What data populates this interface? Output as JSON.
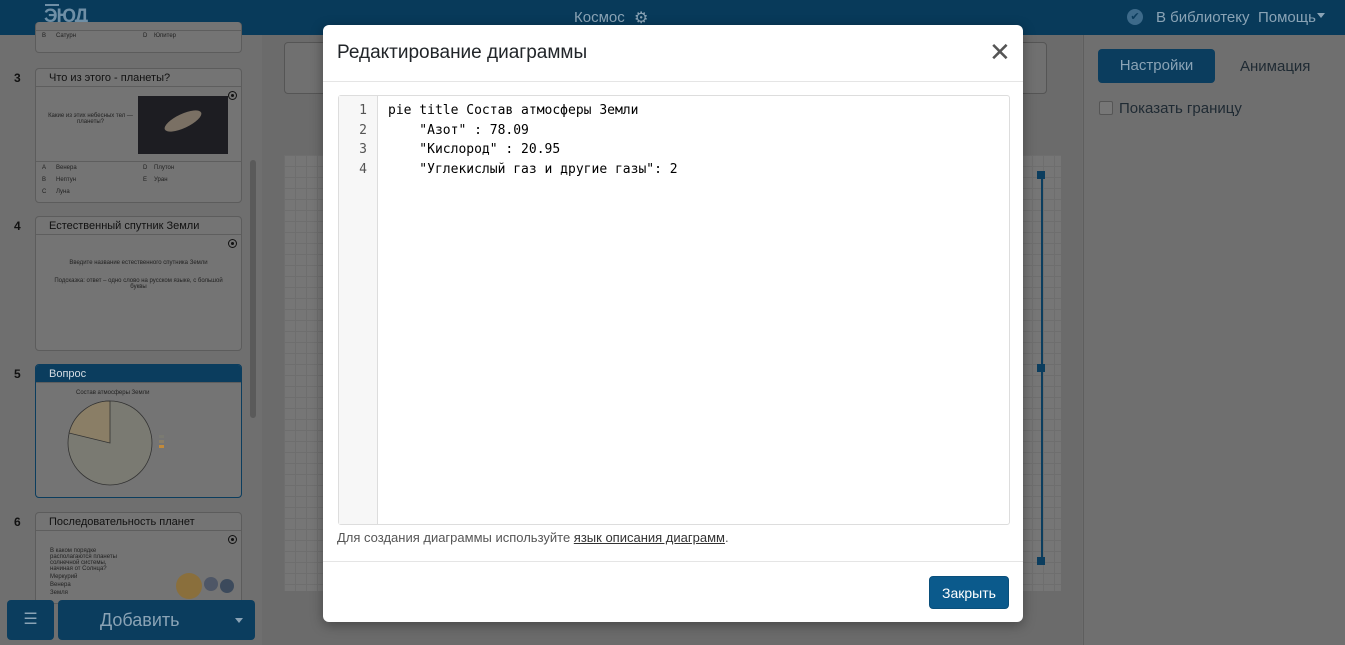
{
  "app": {
    "logo": "ЭЮД",
    "document_title": "Космос",
    "to_library": "В библиотеку",
    "help": "Помощь"
  },
  "sidebar": {
    "slides": [
      {
        "number": "3",
        "title": "Что из этого - планеты?",
        "question": "Какие из этих небесных тел — планеты?",
        "options": [
          "Венера",
          "Плутон",
          "Нептун",
          "Уран",
          "Луна"
        ],
        "option_letters": [
          "A",
          "D",
          "B",
          "E",
          "C"
        ]
      },
      {
        "number": "4",
        "title": "Естественный спутник Земли",
        "question": "Введите название естественного спутника Земли",
        "hint": "Подсказка: ответ – одно слово на русском языке, с большой буквы"
      },
      {
        "number": "5",
        "title": "Вопрос",
        "chart_title": "Состав атмосферы Земли"
      },
      {
        "number": "6",
        "title": "Последовательность планет",
        "question": "В каком порядке располагаются планеты солнечной системы, начиная от Солнца?",
        "options": [
          "Меркурий",
          "Венера",
          "Земля"
        ]
      }
    ],
    "top_partial_options": [
      "Сатурн",
      "Юпитер"
    ],
    "top_partial_letters": [
      "B",
      "D"
    ],
    "add_button": "Добавить"
  },
  "right_panel": {
    "tab_settings": "Настройки",
    "tab_animation": "Анимация",
    "show_border": "Показать границу"
  },
  "modal": {
    "title": "Редактирование диаграммы",
    "line_numbers": [
      "1",
      "2",
      "3",
      "4"
    ],
    "code_lines": [
      "pie title Состав атмосферы Земли",
      "    \"Азот\" : 78.09",
      "    \"Кислород\" : 20.95",
      "    \"Углекислый газ и другие газы\": 2"
    ],
    "hint_prefix": "Для создания диаграммы используйте ",
    "hint_link": "язык описания диаграмм",
    "hint_suffix": ".",
    "close_button": "Закрыть"
  },
  "colors": {
    "brand_dark": "#0b3d5e",
    "primary_button": "#0b5a8c"
  }
}
